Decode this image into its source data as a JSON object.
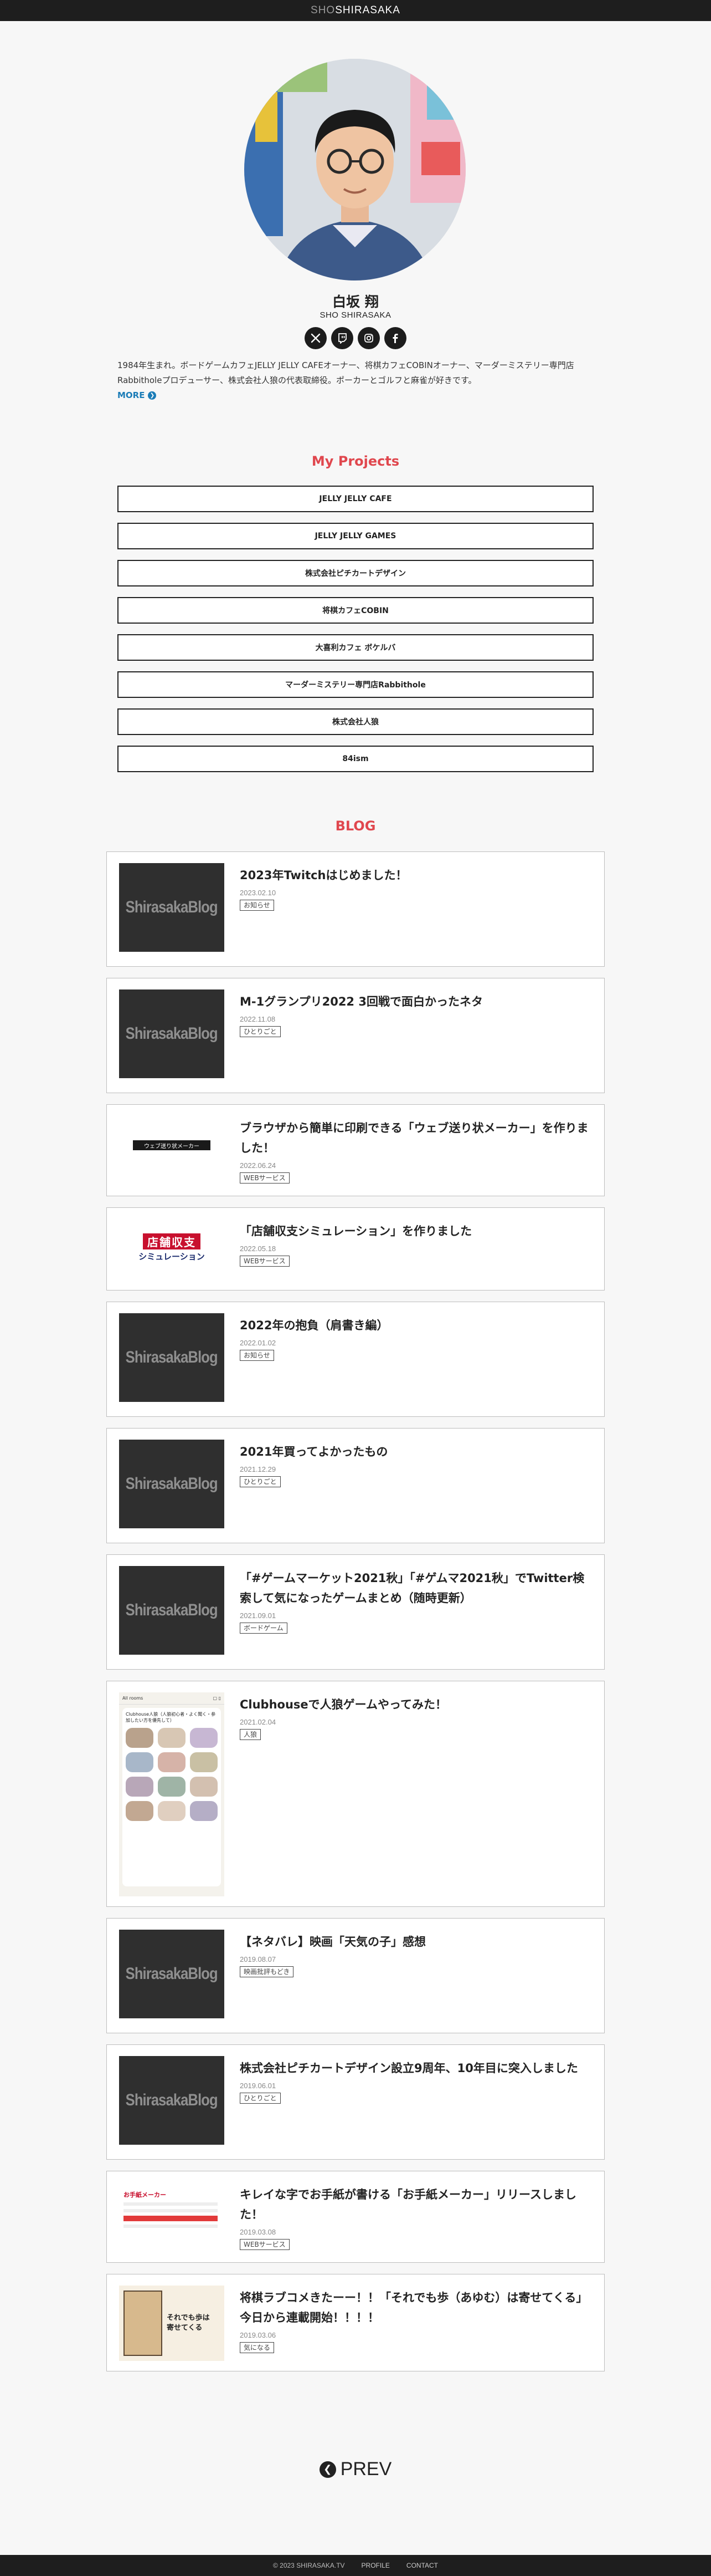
{
  "header": {
    "logo_light": "SHO",
    "logo_bold": "SHIRASAKA"
  },
  "profile": {
    "name_ja": "白坂 翔",
    "name_en": "SHO SHIRASAKA",
    "socials": [
      {
        "icon": "x-icon"
      },
      {
        "icon": "twitch-icon"
      },
      {
        "icon": "instagram-icon"
      },
      {
        "icon": "facebook-icon"
      }
    ],
    "bio": "1984年生まれ。ボードゲームカフェJELLY JELLY CAFEオーナー、将棋カフェCOBINオーナー、マーダーミステリー専門店Rabbitholeプロデューサー、株式会社人狼の代表取締役。ポーカーとゴルフと麻雀が好きです。",
    "more_label": "MORE"
  },
  "projects": {
    "title": "My Projects",
    "items": [
      "JELLY JELLY CAFE",
      "JELLY JELLY GAMES",
      "株式会社ピチカートデザイン",
      "将棋カフェCOBIN",
      "大喜利カフェ ボケルバ",
      "マーダーミステリー専門店Rabbithole",
      "株式会社人狼",
      "84ism"
    ]
  },
  "blog": {
    "title": "BLOG",
    "brand_text": "ShirasakaBlog",
    "posts": [
      {
        "title": "2023年Twitchはじめました！",
        "date": "2023.02.10",
        "tag": "お知らせ"
      },
      {
        "title": "M-1グランプリ2022 3回戦で面白かったネタ",
        "date": "2022.11.08",
        "tag": "ひとりごと"
      },
      {
        "title": "ブラウザから簡単に印刷できる「ウェブ送り状メーカー」を作りました！",
        "date": "2022.06.24",
        "tag": "WEBサービス",
        "thumb_text": "ウェブ送り状メーカー"
      },
      {
        "title": "「店舗収支シミュレーション」を作りました",
        "date": "2022.05.18",
        "tag": "WEBサービス",
        "thumb_top": "店舗収支",
        "thumb_bottom": "シミュレーション"
      },
      {
        "title": "2022年の抱負（肩書き編）",
        "date": "2022.01.02",
        "tag": "お知らせ"
      },
      {
        "title": "2021年買ってよかったもの",
        "date": "2021.12.29",
        "tag": "ひとりごと"
      },
      {
        "title": "「#ゲームマーケット2021秋」「#ゲムマ2021秋」でTwitter検索して気になったゲームまとめ（随時更新）",
        "date": "2021.09.01",
        "tag": "ボードゲーム"
      },
      {
        "title": "Clubhouseで人狼ゲームやってみた！",
        "date": "2021.02.04",
        "tag": "人狼",
        "thumb_header": "All rooms",
        "thumb_room": "Clubhouse人狼（人狼初心者・よく聞く・参加したい方を優先して）"
      },
      {
        "title": "【ネタバレ】映画「天気の子」感想",
        "date": "2019.08.07",
        "tag": "映画批評もどき"
      },
      {
        "title": "株式会社ピチカートデザイン設立9周年、10年目に突入しました",
        "date": "2019.06.01",
        "tag": "ひとりごと"
      },
      {
        "title": "キレイな字でお手紙が書ける「お手紙メーカー」リリースしました！",
        "date": "2019.03.08",
        "tag": "WEBサービス",
        "thumb_text": "お手紙メーカー"
      },
      {
        "title": "将棋ラブコメきたーー！！「それでも歩（あゆむ）は寄せてくる」今日から連載開始！！！！",
        "date": "2019.03.06",
        "tag": "気になる",
        "thumb_text": "それでも歩は寄せてくる"
      }
    ]
  },
  "pagination": {
    "prev_label": "PREV"
  },
  "footer": {
    "copyright": "© 2023 SHIRASAKA.TV",
    "links": [
      "PROFILE",
      "CONTACT"
    ]
  }
}
